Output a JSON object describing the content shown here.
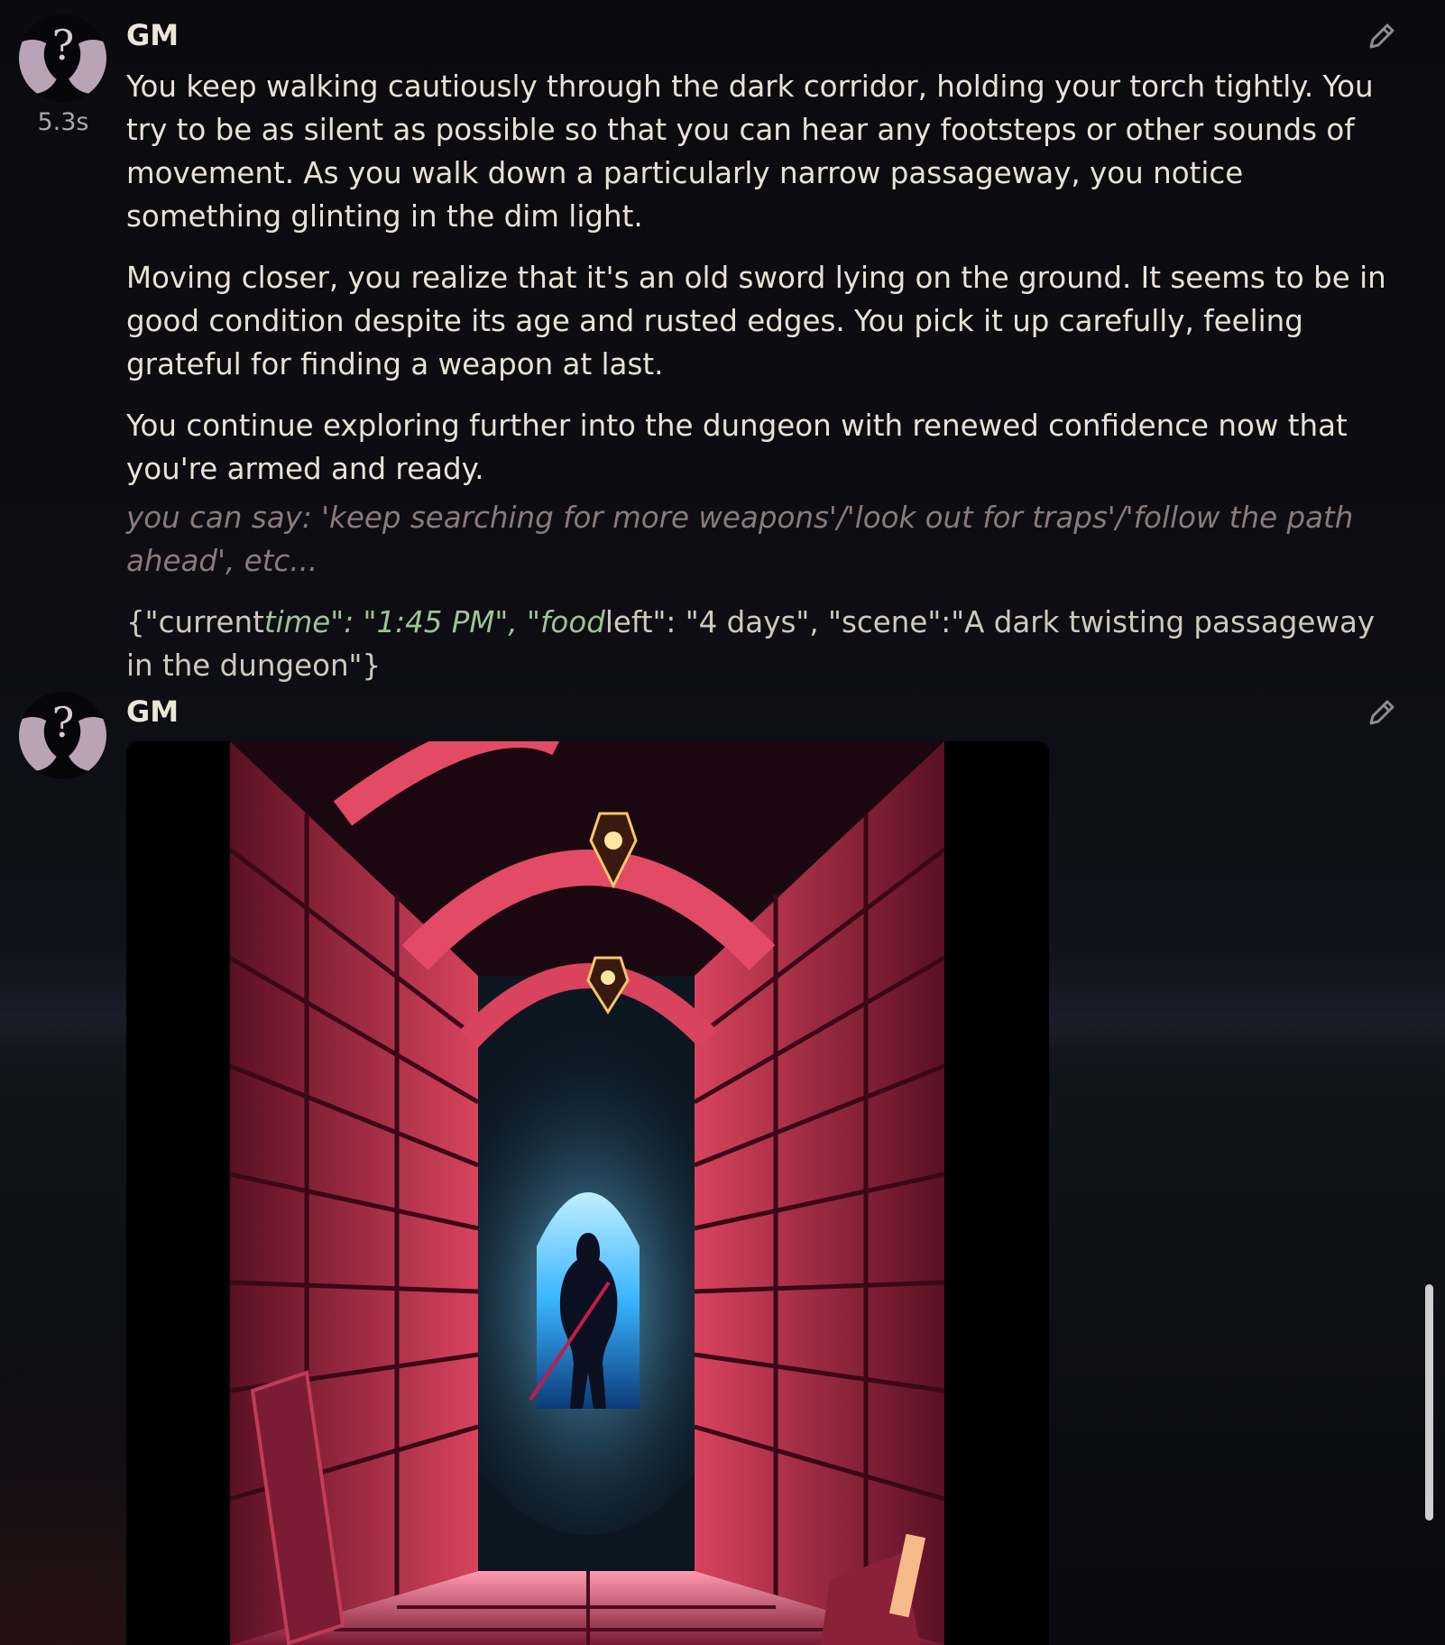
{
  "messages": [
    {
      "author": "GM",
      "timer": "5.3s",
      "paragraphs": [
        "You keep walking cautiously through the dark corridor, holding your torch tightly. You try to be as silent as possible so that you can hear any footsteps or other sounds of movement. As you walk down a particularly narrow passageway, you notice something glinting in the dim light.",
        "Moving closer, you realize that it's an old sword lying on the ground. It seems to be in good condition despite its age and rusted edges. You pick it up carefully, feeling grateful for finding a weapon at last.",
        "You continue exploring further into the dungeon with renewed confidence now that you're armed and ready."
      ],
      "suggestion": "you can say: 'keep searching for more weapons'/'look out for traps'/'follow the path ahead', etc...",
      "status": {
        "part1": "{\"current",
        "part2": "time\": \"1:45 PM\", \"food",
        "part3": "left\": \"4 days\", \"scene\":\"A dark twisting passageway in the dungeon\"}"
      }
    },
    {
      "author": "GM",
      "image_subject": "dungeon corridor"
    }
  ],
  "icons": {
    "avatar": "question-silhouette-icon",
    "edit": "pencil-icon"
  },
  "colors": {
    "accent_red": "#d9435e",
    "status_green": "#9ec394",
    "suggestion_muted": "#8a7a7a"
  }
}
